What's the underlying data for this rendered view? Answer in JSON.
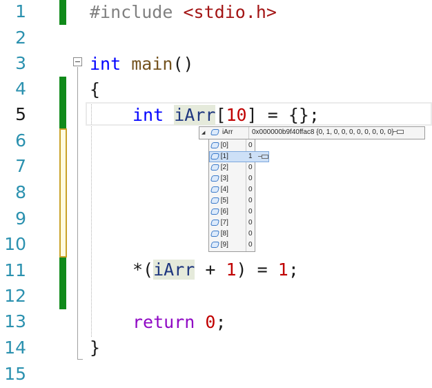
{
  "editor": {
    "line_numbers": [
      "1",
      "2",
      "3",
      "4",
      "5",
      "6",
      "7",
      "8",
      "9",
      "10",
      "11",
      "12",
      "13",
      "14",
      "15"
    ],
    "current_line": "5",
    "code": {
      "l1_directive": "#include",
      "l1_header": "<stdio.h>",
      "l3_type": "int",
      "l3_func": "main",
      "l3_parens": "()",
      "l4": "{",
      "l5_type": "int",
      "l5_var": "iArr",
      "l5_open": "[",
      "l5_size": "10",
      "l5_rest": "] = {};",
      "l11_deref": "*(",
      "l11_var": "iArr",
      "l11_plus": " + ",
      "l11_one": "1",
      "l11_mid": ") = ",
      "l11_val": "1",
      "l11_end": ";",
      "l13_kw": "return",
      "l13_val": "0",
      "l13_end": ";",
      "l14": "}"
    }
  },
  "datatip": {
    "expander": "◢",
    "name": "iArr",
    "value": "0x000000b9f40ffac8 {0, 1, 0, 0, 0, 0, 0, 0, 0, 0}",
    "items": [
      {
        "name": "[0]",
        "value": "0"
      },
      {
        "name": "[1]",
        "value": "1"
      },
      {
        "name": "[2]",
        "value": "0"
      },
      {
        "name": "[3]",
        "value": "0"
      },
      {
        "name": "[4]",
        "value": "0"
      },
      {
        "name": "[5]",
        "value": "0"
      },
      {
        "name": "[6]",
        "value": "0"
      },
      {
        "name": "[7]",
        "value": "0"
      },
      {
        "name": "[8]",
        "value": "0"
      },
      {
        "name": "[9]",
        "value": "0"
      }
    ],
    "selected_index": 1,
    "icon_name": "variable-cube-icon",
    "pin_icon": "pin-icon"
  },
  "colors": {
    "keyword": "#0000ff",
    "number": "#c00000",
    "return_keyword": "#8f08c4",
    "saved_change_bar": "#108a1a",
    "unsaved_change_bar": "#c9a227",
    "line_number": "#2b91af"
  }
}
